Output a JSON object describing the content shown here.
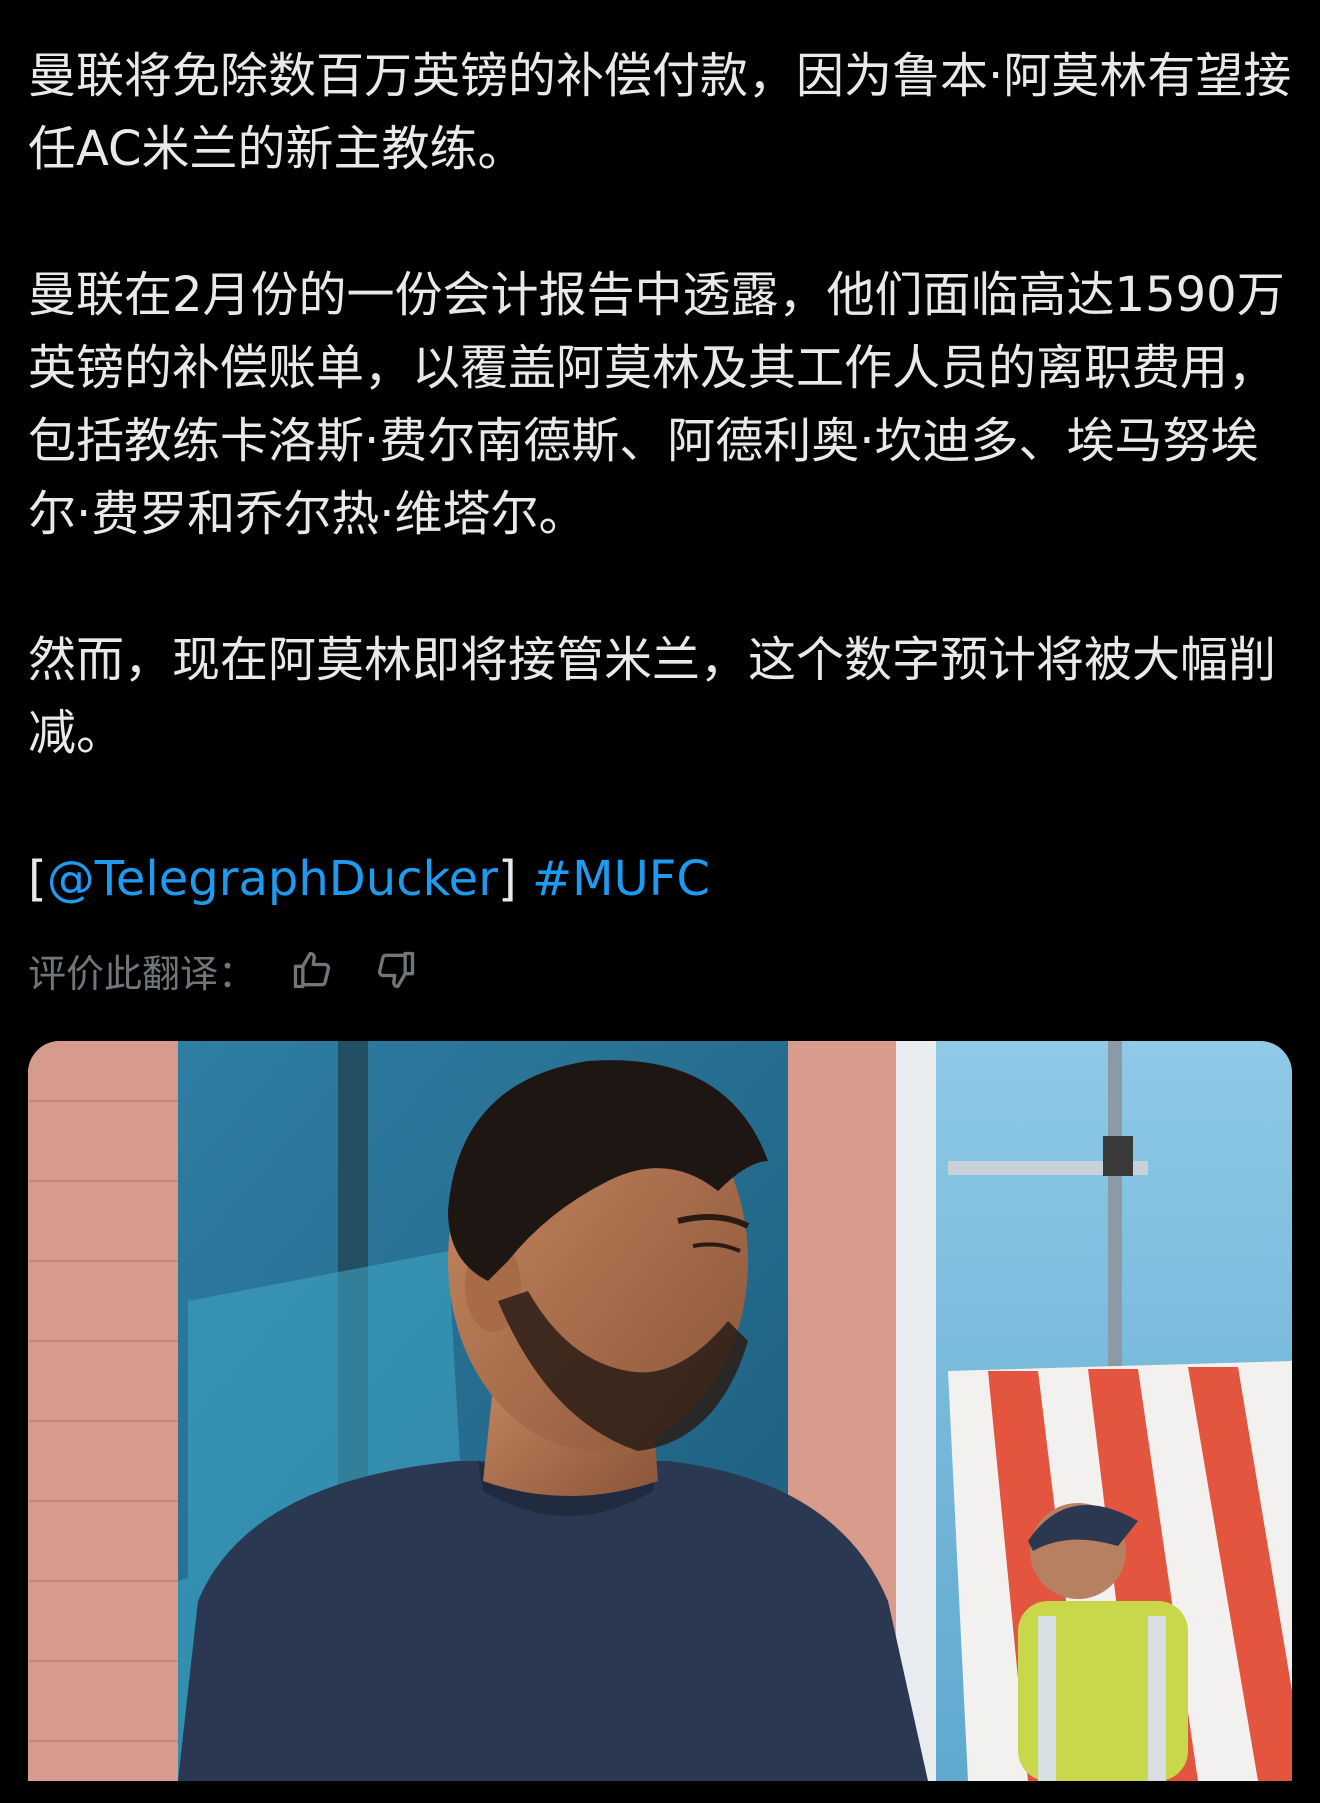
{
  "post": {
    "paragraphs": [
      "曼联将免除数百万英镑的补偿付款，因为鲁本·阿莫林有望接任AC米兰的新主教练。",
      "曼联在2月份的一份会计报告中透露，他们面临高达1590万英镑的补偿账单，以覆盖阿莫林及其工作人员的离职费用，包括教练卡洛斯·费尔南德斯、阿德利奥·坎迪多、埃马努埃尔·费罗和乔尔热·维塔尔。",
      "然而，现在阿莫林即将接管米兰，这个数字预计将被大幅削减。"
    ],
    "bracket_open": "[",
    "mention": "@TelegraphDucker",
    "bracket_close": "]",
    "hashtag": "#MUFC"
  },
  "translation_rating": {
    "label": "评价此翻译：",
    "thumbs_up_icon": "thumbs-up-icon",
    "thumbs_down_icon": "thumbs-down-icon"
  },
  "media": {
    "type": "photo"
  },
  "colors": {
    "background": "#000000",
    "text": "#e7e9ea",
    "muted": "#71767b",
    "link": "#1d9bf0"
  }
}
